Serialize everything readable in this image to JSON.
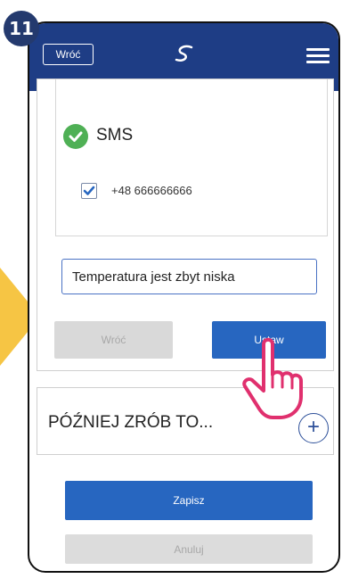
{
  "step": {
    "number": "11"
  },
  "header": {
    "back_label": "Wróć",
    "logo_icon": "salus-s-logo-icon",
    "menu_icon": "hamburger-menu-icon",
    "bg_color": "#1e3d85"
  },
  "notification": {
    "channel_label": "SMS",
    "channel_icon": "green-check-circle-icon",
    "phone_numbers": [
      {
        "number": "+48 666666666",
        "checked": true
      }
    ],
    "message_value": "Temperatura jest zbyt niska",
    "back_button": "Wróć",
    "set_button": "Ustaw"
  },
  "later": {
    "label": "PÓŹNIEJ ZRÓB TO...",
    "add_icon": "plus-circle-icon"
  },
  "footer": {
    "save_button": "Zapisz",
    "cancel_button": "Anuluj"
  },
  "colors": {
    "primary": "#2766c0",
    "success": "#4fb055",
    "highlight_arrow": "#f6c544",
    "pointer": "#e0306e"
  }
}
